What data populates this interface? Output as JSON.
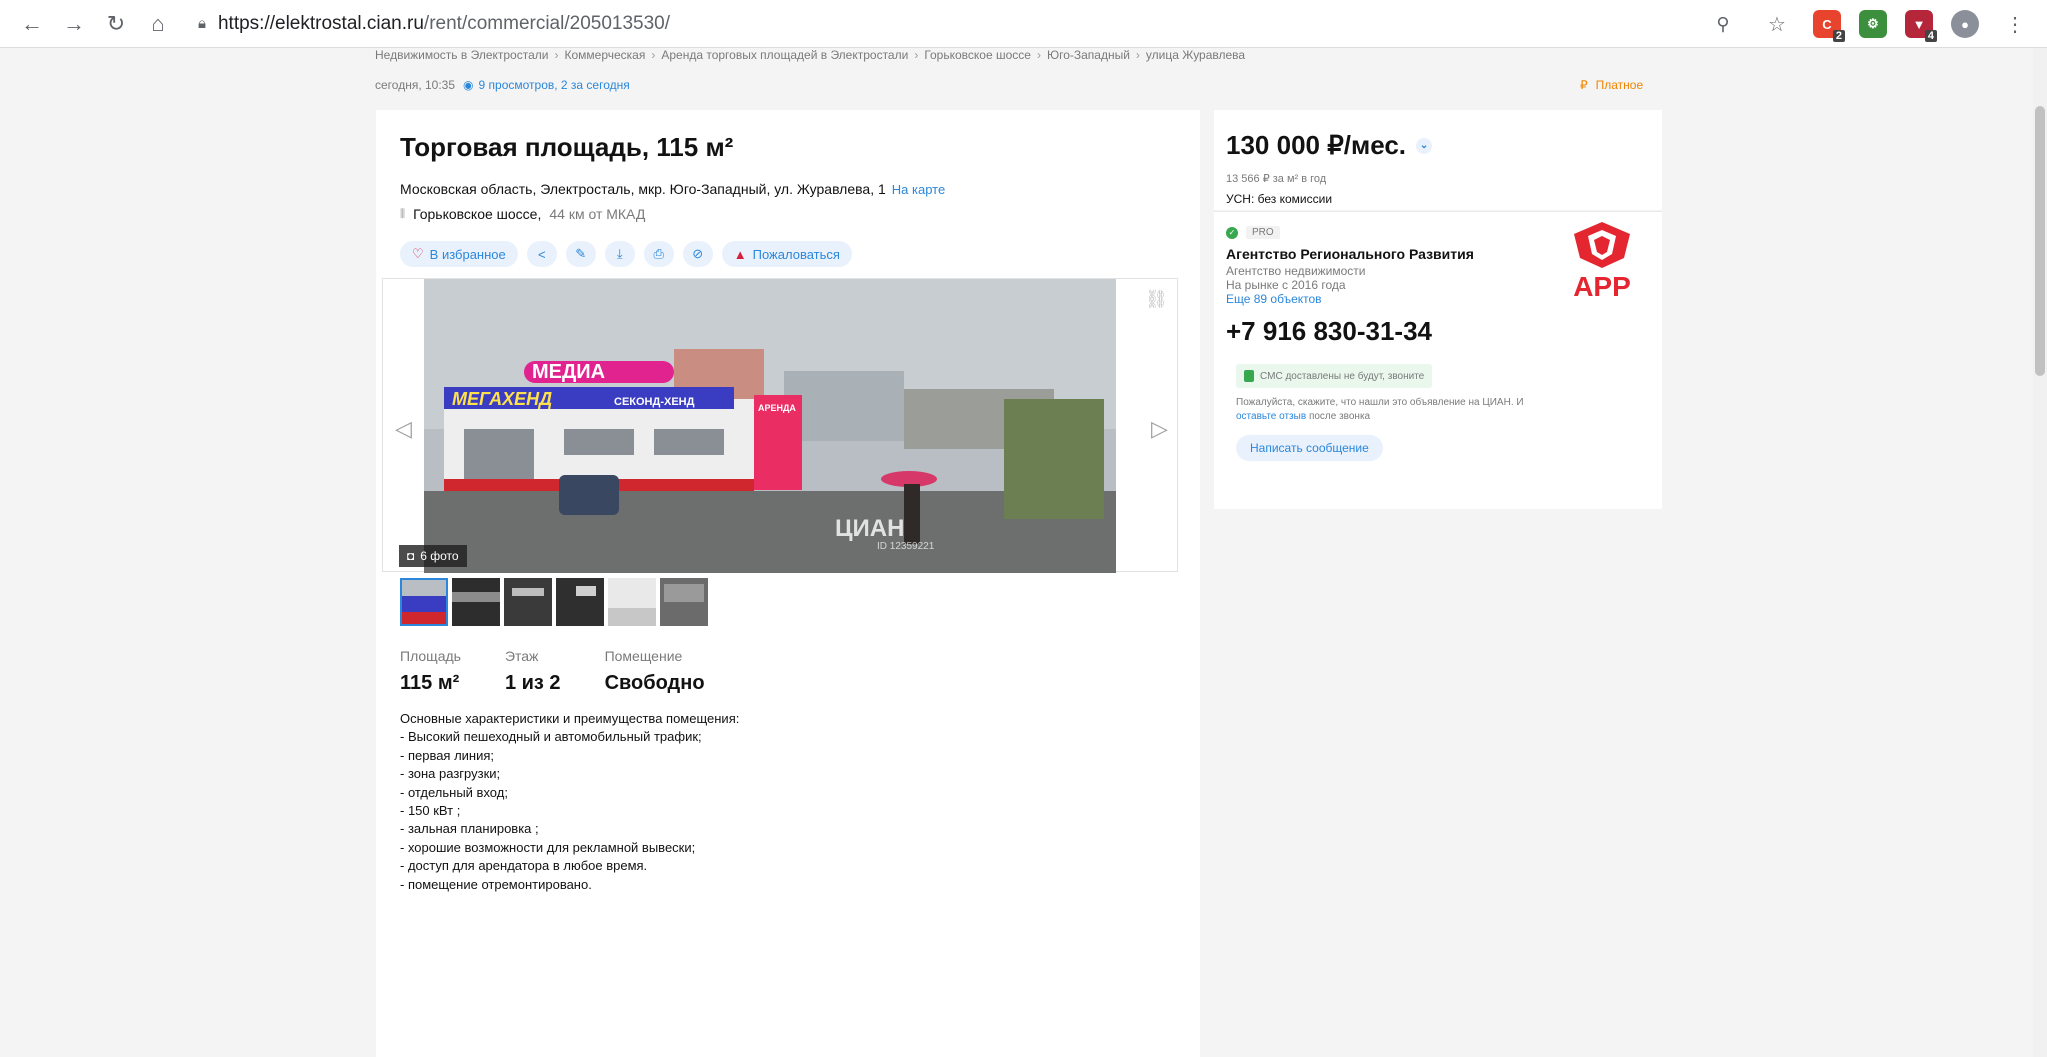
{
  "browser": {
    "url_host": "https://elektrostal.cian.ru",
    "url_path": "/rent/commercial/205013530/",
    "back_icon": "arrow-left",
    "forward_icon": "arrow-right",
    "reload_icon": "reload",
    "home_icon": "home",
    "ext_badges": [
      "2",
      "4"
    ]
  },
  "breadcrumbs": [
    "Недвижимость в Электростали",
    "Коммерческая",
    "Аренда торговых площадей в Электростали",
    "Горьковское шоссе",
    "Юго-Западный",
    "улица Журавлева"
  ],
  "meta": {
    "date": "сегодня, 10:35",
    "views": "9 просмотров, 2 за сегодня",
    "paid": "Платное",
    "paid_icon": "₽"
  },
  "listing": {
    "title": "Торговая площадь, 115 м²",
    "address": "Московская область, Электросталь, мкр. Юго-Западный, ул. Журавлева, 1",
    "map_link": "На карте",
    "highway": "Горьковское шоссе,",
    "distance": "44 км от МКАД",
    "actions": {
      "favorite": "В избранное",
      "complain": "Пожаловаться"
    },
    "photo_count": "6 фото",
    "watermark": "ЦИАН",
    "watermark_id": "ID 12359221",
    "facts": [
      {
        "label": "Площадь",
        "value": "115 м²"
      },
      {
        "label": "Этаж",
        "value": "1 из 2"
      },
      {
        "label": "Помещение",
        "value": "Свободно"
      }
    ],
    "description": [
      "Основные характеристики и преимущества помещения:",
      "- Высокий пешеходный и автомобильный трафик;",
      "- первая линия;",
      "- зона разгрузки;",
      "- отдельный вход;",
      "- 150 кВт ;",
      "- зальная планировка ;",
      "- хорошие возможности для рекламной вывески;",
      "- доступ для арендатора в любое время.",
      "- помещение отремонтировано."
    ],
    "photo_signs": {
      "media": "МЕДИА",
      "megahend": "МЕГАХЕНД",
      "second_hand": "СЕКОНД-ХЕНД",
      "rent": "АРЕНДА"
    }
  },
  "price": {
    "amount": "130 000 ₽/мес.",
    "per_meter": "13 566 ₽ за м² в год",
    "tax": "УСН: без комиссии"
  },
  "agent": {
    "pro_label": "PRO",
    "name": "Агентство Регионального Развития",
    "type": "Агентство недвижимости",
    "years": "На рынке с 2016 года",
    "more": "Еще 89 объектов",
    "logo_text": "АРР",
    "phone": "+7 916 830-31-34",
    "sms_note": "СМС доставлены не будут, звоните",
    "hint_prefix": "Пожалуйста, скажите, что нашли это объявление на ЦИАН. И",
    "hint_link": "оставьте отзыв",
    "hint_suffix": "после звонка",
    "message_button": "Написать сообщение"
  },
  "colors": {
    "accent": "#2b87db",
    "accent_bg": "#e9f1fc",
    "danger": "#d61f3b",
    "paid": "#f08400",
    "logo_red": "#e3262f"
  }
}
